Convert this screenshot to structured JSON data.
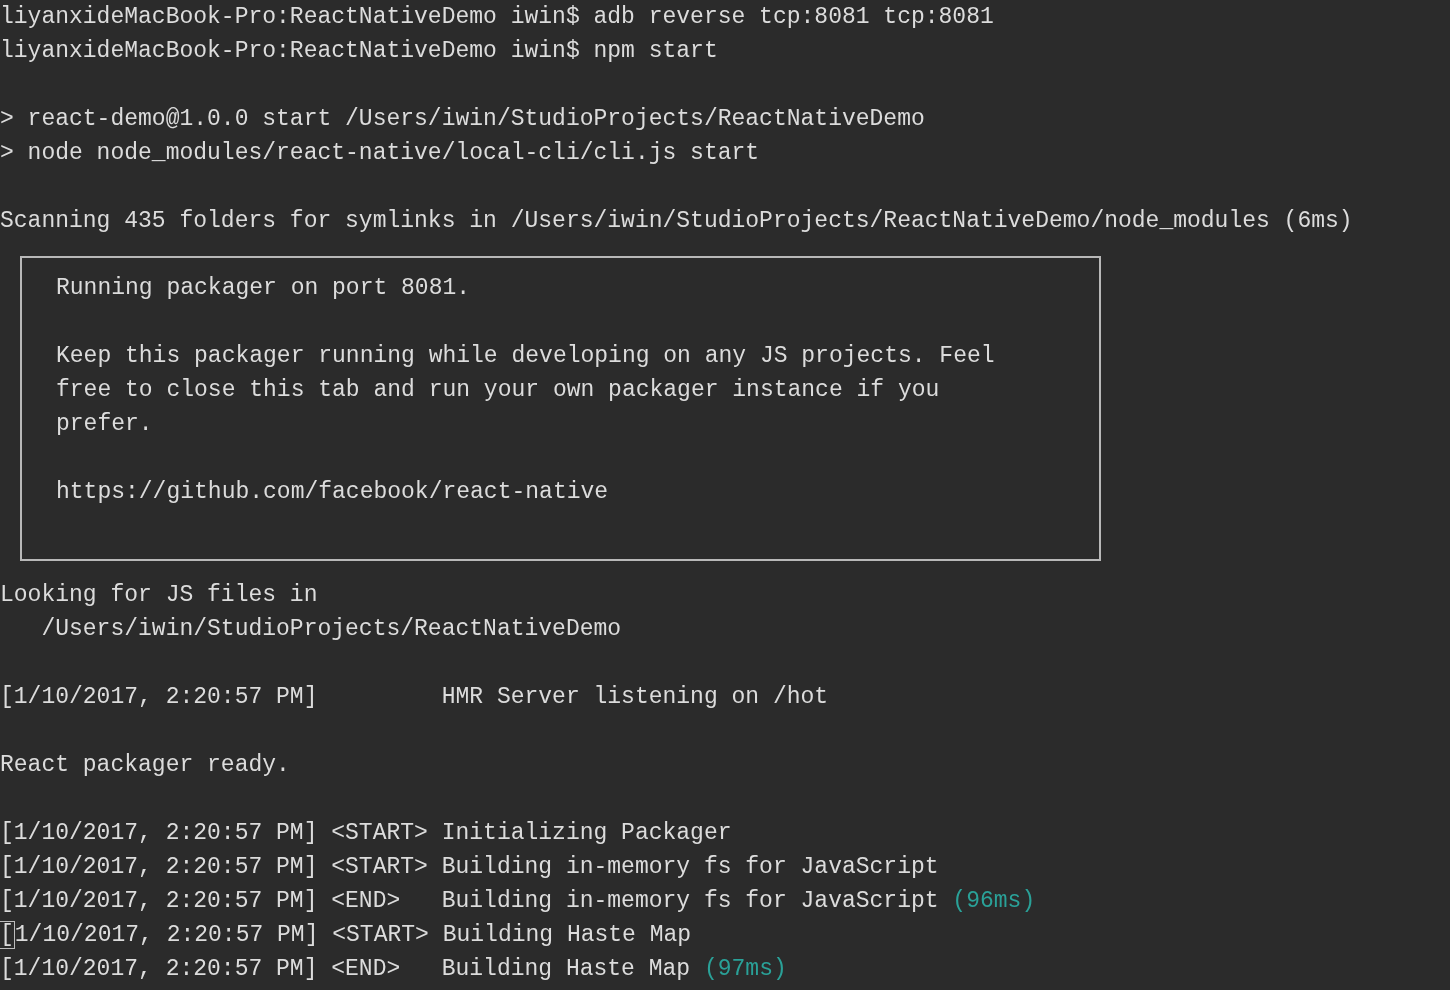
{
  "lines": [
    {
      "kind": "text",
      "text": "liyanxideMacBook-Pro:ReactNativeDemo iwin$ adb reverse tcp:8081 tcp:8081"
    },
    {
      "kind": "text",
      "text": "liyanxideMacBook-Pro:ReactNativeDemo iwin$ npm start"
    },
    {
      "kind": "blank"
    },
    {
      "kind": "text",
      "text": "> react-demo@1.0.0 start /Users/iwin/StudioProjects/ReactNativeDemo"
    },
    {
      "kind": "text",
      "text": "> node node_modules/react-native/local-cli/cli.js start"
    },
    {
      "kind": "blank"
    },
    {
      "kind": "text",
      "text": "Scanning 435 folders for symlinks in /Users/iwin/StudioProjects/ReactNativeDemo/node_modules (6ms)"
    },
    {
      "kind": "box",
      "lines": [
        {
          "kind": "text",
          "text": "Running packager on port 8081."
        },
        {
          "kind": "blank"
        },
        {
          "kind": "text",
          "text": "Keep this packager running while developing on any JS projects. Feel"
        },
        {
          "kind": "text",
          "text": "free to close this tab and run your own packager instance if you"
        },
        {
          "kind": "text",
          "text": "prefer."
        },
        {
          "kind": "blank"
        },
        {
          "kind": "text",
          "text": "https://github.com/facebook/react-native"
        },
        {
          "kind": "blank"
        }
      ]
    },
    {
      "kind": "text",
      "text": "Looking for JS files in"
    },
    {
      "kind": "text",
      "text": "   /Users/iwin/StudioProjects/ReactNativeDemo"
    },
    {
      "kind": "blank"
    },
    {
      "kind": "text",
      "text": "[1/10/2017, 2:20:57 PM]         HMR Server listening on /hot"
    },
    {
      "kind": "blank"
    },
    {
      "kind": "text",
      "text": "React packager ready."
    },
    {
      "kind": "blank"
    },
    {
      "kind": "text",
      "text": "[1/10/2017, 2:20:57 PM] <START> Initializing Packager"
    },
    {
      "kind": "text",
      "text": "[1/10/2017, 2:20:57 PM] <START> Building in-memory fs for JavaScript"
    },
    {
      "kind": "text",
      "text": "[1/10/2017, 2:20:57 PM] <END>   Building in-memory fs for JavaScript",
      "duration": "(96ms)"
    },
    {
      "kind": "text",
      "text": "[1/10/2017, 2:20:57 PM] <START> Building Haste Map",
      "cursor": true
    },
    {
      "kind": "text",
      "text": "[1/10/2017, 2:20:57 PM] <END>   Building Haste Map",
      "duration": "(97ms)"
    }
  ]
}
